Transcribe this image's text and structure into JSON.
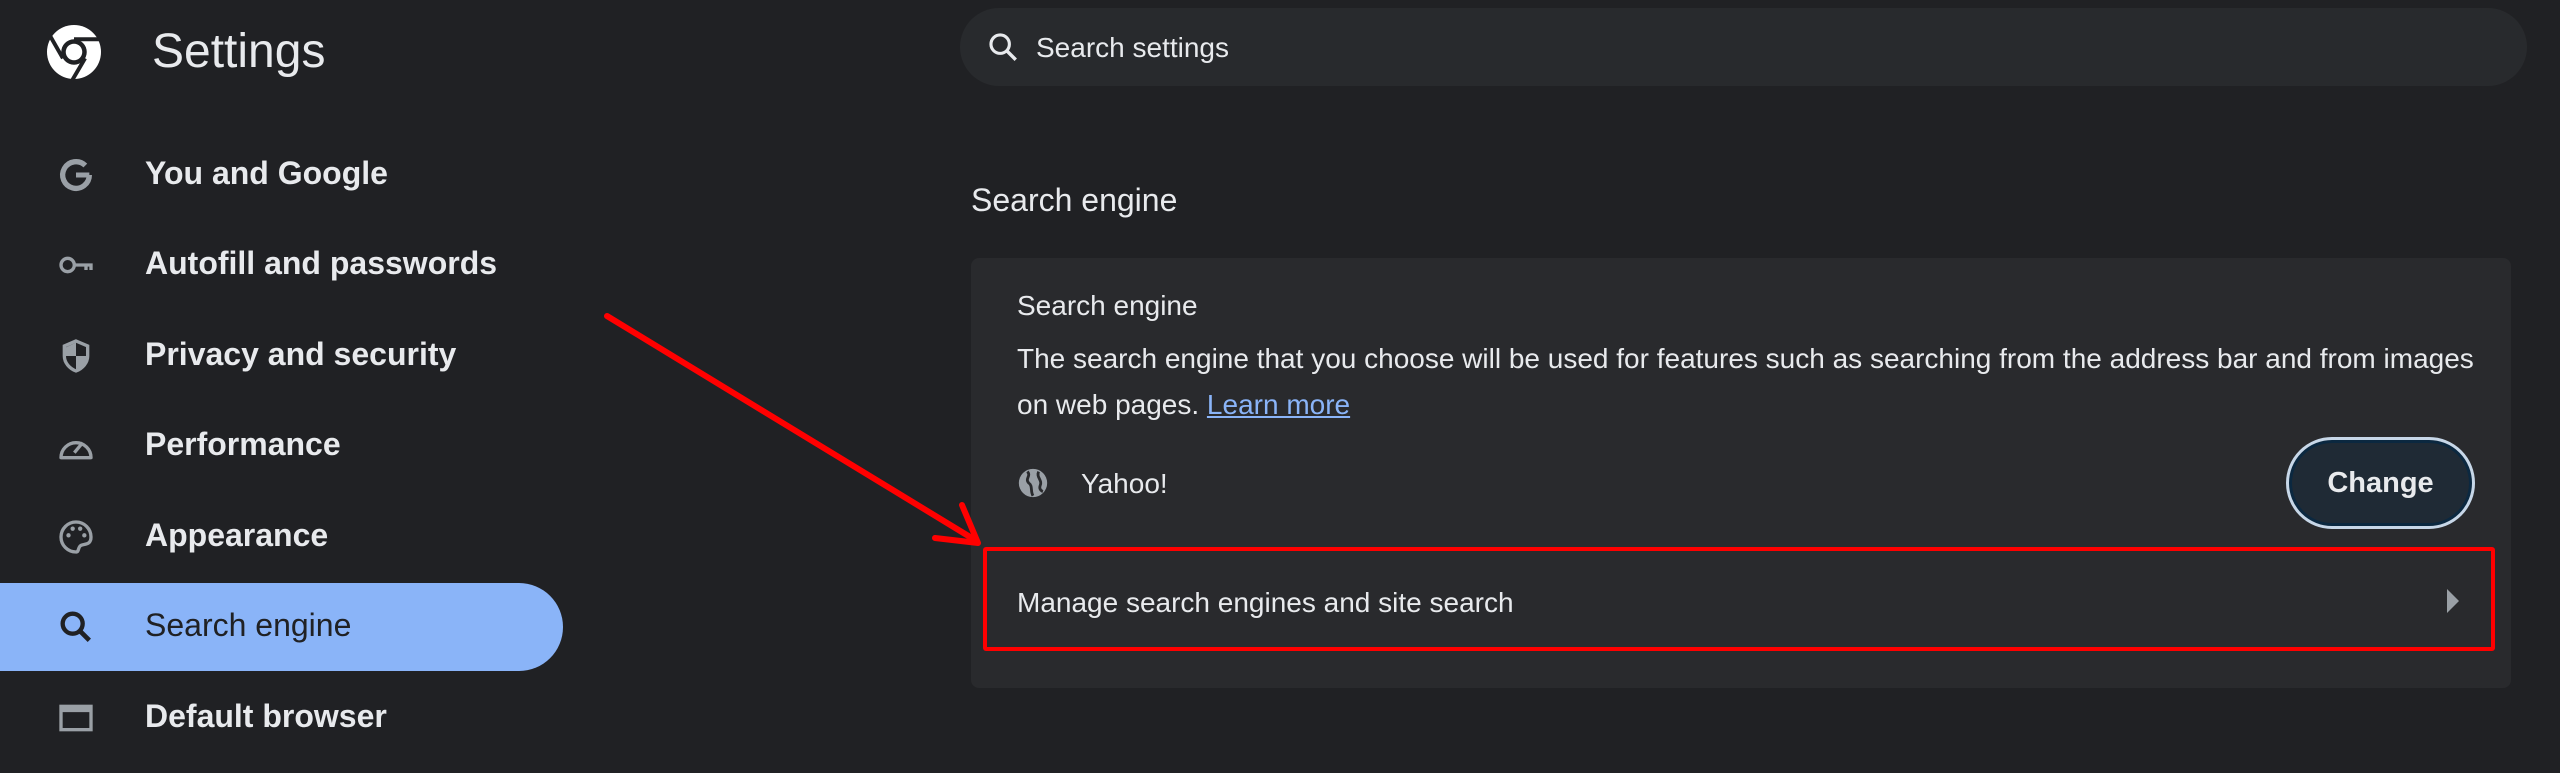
{
  "header": {
    "title": "Settings",
    "logo_icon": "chrome-icon"
  },
  "search": {
    "placeholder": "Search settings",
    "icon": "search-icon"
  },
  "sidebar": {
    "items": [
      {
        "label": "You and Google",
        "icon": "google-icon"
      },
      {
        "label": "Autofill and passwords",
        "icon": "key-icon"
      },
      {
        "label": "Privacy and security",
        "icon": "shield-icon"
      },
      {
        "label": "Performance",
        "icon": "speedometer-icon"
      },
      {
        "label": "Appearance",
        "icon": "palette-icon"
      },
      {
        "label": "Search engine",
        "icon": "search-icon",
        "selected": true
      },
      {
        "label": "Default browser",
        "icon": "browser-window-icon"
      }
    ]
  },
  "main": {
    "section_heading": "Search engine",
    "card": {
      "title": "Search engine",
      "description": "The search engine that you choose will be used for features such as searching from the address bar and from images on web pages.",
      "learn_more": "Learn more",
      "current_engine": "Yahoo!",
      "change_label": "Change",
      "manage_label": "Manage search engines and site search"
    }
  },
  "colors": {
    "background": "#202124",
    "card": "#292a2d",
    "accent": "#8ab4f8",
    "annotation": "#ff0000"
  }
}
